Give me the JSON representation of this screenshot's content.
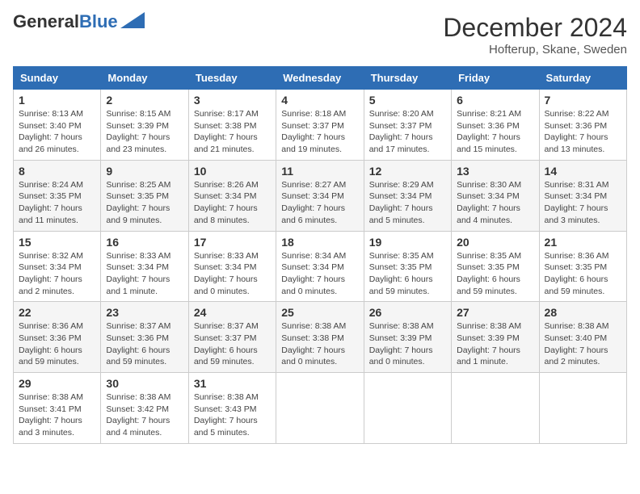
{
  "header": {
    "logo_general": "General",
    "logo_blue": "Blue",
    "month": "December 2024",
    "location": "Hofterup, Skane, Sweden"
  },
  "weekdays": [
    "Sunday",
    "Monday",
    "Tuesday",
    "Wednesday",
    "Thursday",
    "Friday",
    "Saturday"
  ],
  "weeks": [
    [
      {
        "day": "1",
        "sunrise": "8:13 AM",
        "sunset": "3:40 PM",
        "daylight": "7 hours and 26 minutes."
      },
      {
        "day": "2",
        "sunrise": "8:15 AM",
        "sunset": "3:39 PM",
        "daylight": "7 hours and 23 minutes."
      },
      {
        "day": "3",
        "sunrise": "8:17 AM",
        "sunset": "3:38 PM",
        "daylight": "7 hours and 21 minutes."
      },
      {
        "day": "4",
        "sunrise": "8:18 AM",
        "sunset": "3:37 PM",
        "daylight": "7 hours and 19 minutes."
      },
      {
        "day": "5",
        "sunrise": "8:20 AM",
        "sunset": "3:37 PM",
        "daylight": "7 hours and 17 minutes."
      },
      {
        "day": "6",
        "sunrise": "8:21 AM",
        "sunset": "3:36 PM",
        "daylight": "7 hours and 15 minutes."
      },
      {
        "day": "7",
        "sunrise": "8:22 AM",
        "sunset": "3:36 PM",
        "daylight": "7 hours and 13 minutes."
      }
    ],
    [
      {
        "day": "8",
        "sunrise": "8:24 AM",
        "sunset": "3:35 PM",
        "daylight": "7 hours and 11 minutes."
      },
      {
        "day": "9",
        "sunrise": "8:25 AM",
        "sunset": "3:35 PM",
        "daylight": "7 hours and 9 minutes."
      },
      {
        "day": "10",
        "sunrise": "8:26 AM",
        "sunset": "3:34 PM",
        "daylight": "7 hours and 8 minutes."
      },
      {
        "day": "11",
        "sunrise": "8:27 AM",
        "sunset": "3:34 PM",
        "daylight": "7 hours and 6 minutes."
      },
      {
        "day": "12",
        "sunrise": "8:29 AM",
        "sunset": "3:34 PM",
        "daylight": "7 hours and 5 minutes."
      },
      {
        "day": "13",
        "sunrise": "8:30 AM",
        "sunset": "3:34 PM",
        "daylight": "7 hours and 4 minutes."
      },
      {
        "day": "14",
        "sunrise": "8:31 AM",
        "sunset": "3:34 PM",
        "daylight": "7 hours and 3 minutes."
      }
    ],
    [
      {
        "day": "15",
        "sunrise": "8:32 AM",
        "sunset": "3:34 PM",
        "daylight": "7 hours and 2 minutes."
      },
      {
        "day": "16",
        "sunrise": "8:33 AM",
        "sunset": "3:34 PM",
        "daylight": "7 hours and 1 minute."
      },
      {
        "day": "17",
        "sunrise": "8:33 AM",
        "sunset": "3:34 PM",
        "daylight": "7 hours and 0 minutes."
      },
      {
        "day": "18",
        "sunrise": "8:34 AM",
        "sunset": "3:34 PM",
        "daylight": "7 hours and 0 minutes."
      },
      {
        "day": "19",
        "sunrise": "8:35 AM",
        "sunset": "3:35 PM",
        "daylight": "6 hours and 59 minutes."
      },
      {
        "day": "20",
        "sunrise": "8:35 AM",
        "sunset": "3:35 PM",
        "daylight": "6 hours and 59 minutes."
      },
      {
        "day": "21",
        "sunrise": "8:36 AM",
        "sunset": "3:35 PM",
        "daylight": "6 hours and 59 minutes."
      }
    ],
    [
      {
        "day": "22",
        "sunrise": "8:36 AM",
        "sunset": "3:36 PM",
        "daylight": "6 hours and 59 minutes."
      },
      {
        "day": "23",
        "sunrise": "8:37 AM",
        "sunset": "3:36 PM",
        "daylight": "6 hours and 59 minutes."
      },
      {
        "day": "24",
        "sunrise": "8:37 AM",
        "sunset": "3:37 PM",
        "daylight": "6 hours and 59 minutes."
      },
      {
        "day": "25",
        "sunrise": "8:38 AM",
        "sunset": "3:38 PM",
        "daylight": "7 hours and 0 minutes."
      },
      {
        "day": "26",
        "sunrise": "8:38 AM",
        "sunset": "3:39 PM",
        "daylight": "7 hours and 0 minutes."
      },
      {
        "day": "27",
        "sunrise": "8:38 AM",
        "sunset": "3:39 PM",
        "daylight": "7 hours and 1 minute."
      },
      {
        "day": "28",
        "sunrise": "8:38 AM",
        "sunset": "3:40 PM",
        "daylight": "7 hours and 2 minutes."
      }
    ],
    [
      {
        "day": "29",
        "sunrise": "8:38 AM",
        "sunset": "3:41 PM",
        "daylight": "7 hours and 3 minutes."
      },
      {
        "day": "30",
        "sunrise": "8:38 AM",
        "sunset": "3:42 PM",
        "daylight": "7 hours and 4 minutes."
      },
      {
        "day": "31",
        "sunrise": "8:38 AM",
        "sunset": "3:43 PM",
        "daylight": "7 hours and 5 minutes."
      },
      null,
      null,
      null,
      null
    ]
  ]
}
